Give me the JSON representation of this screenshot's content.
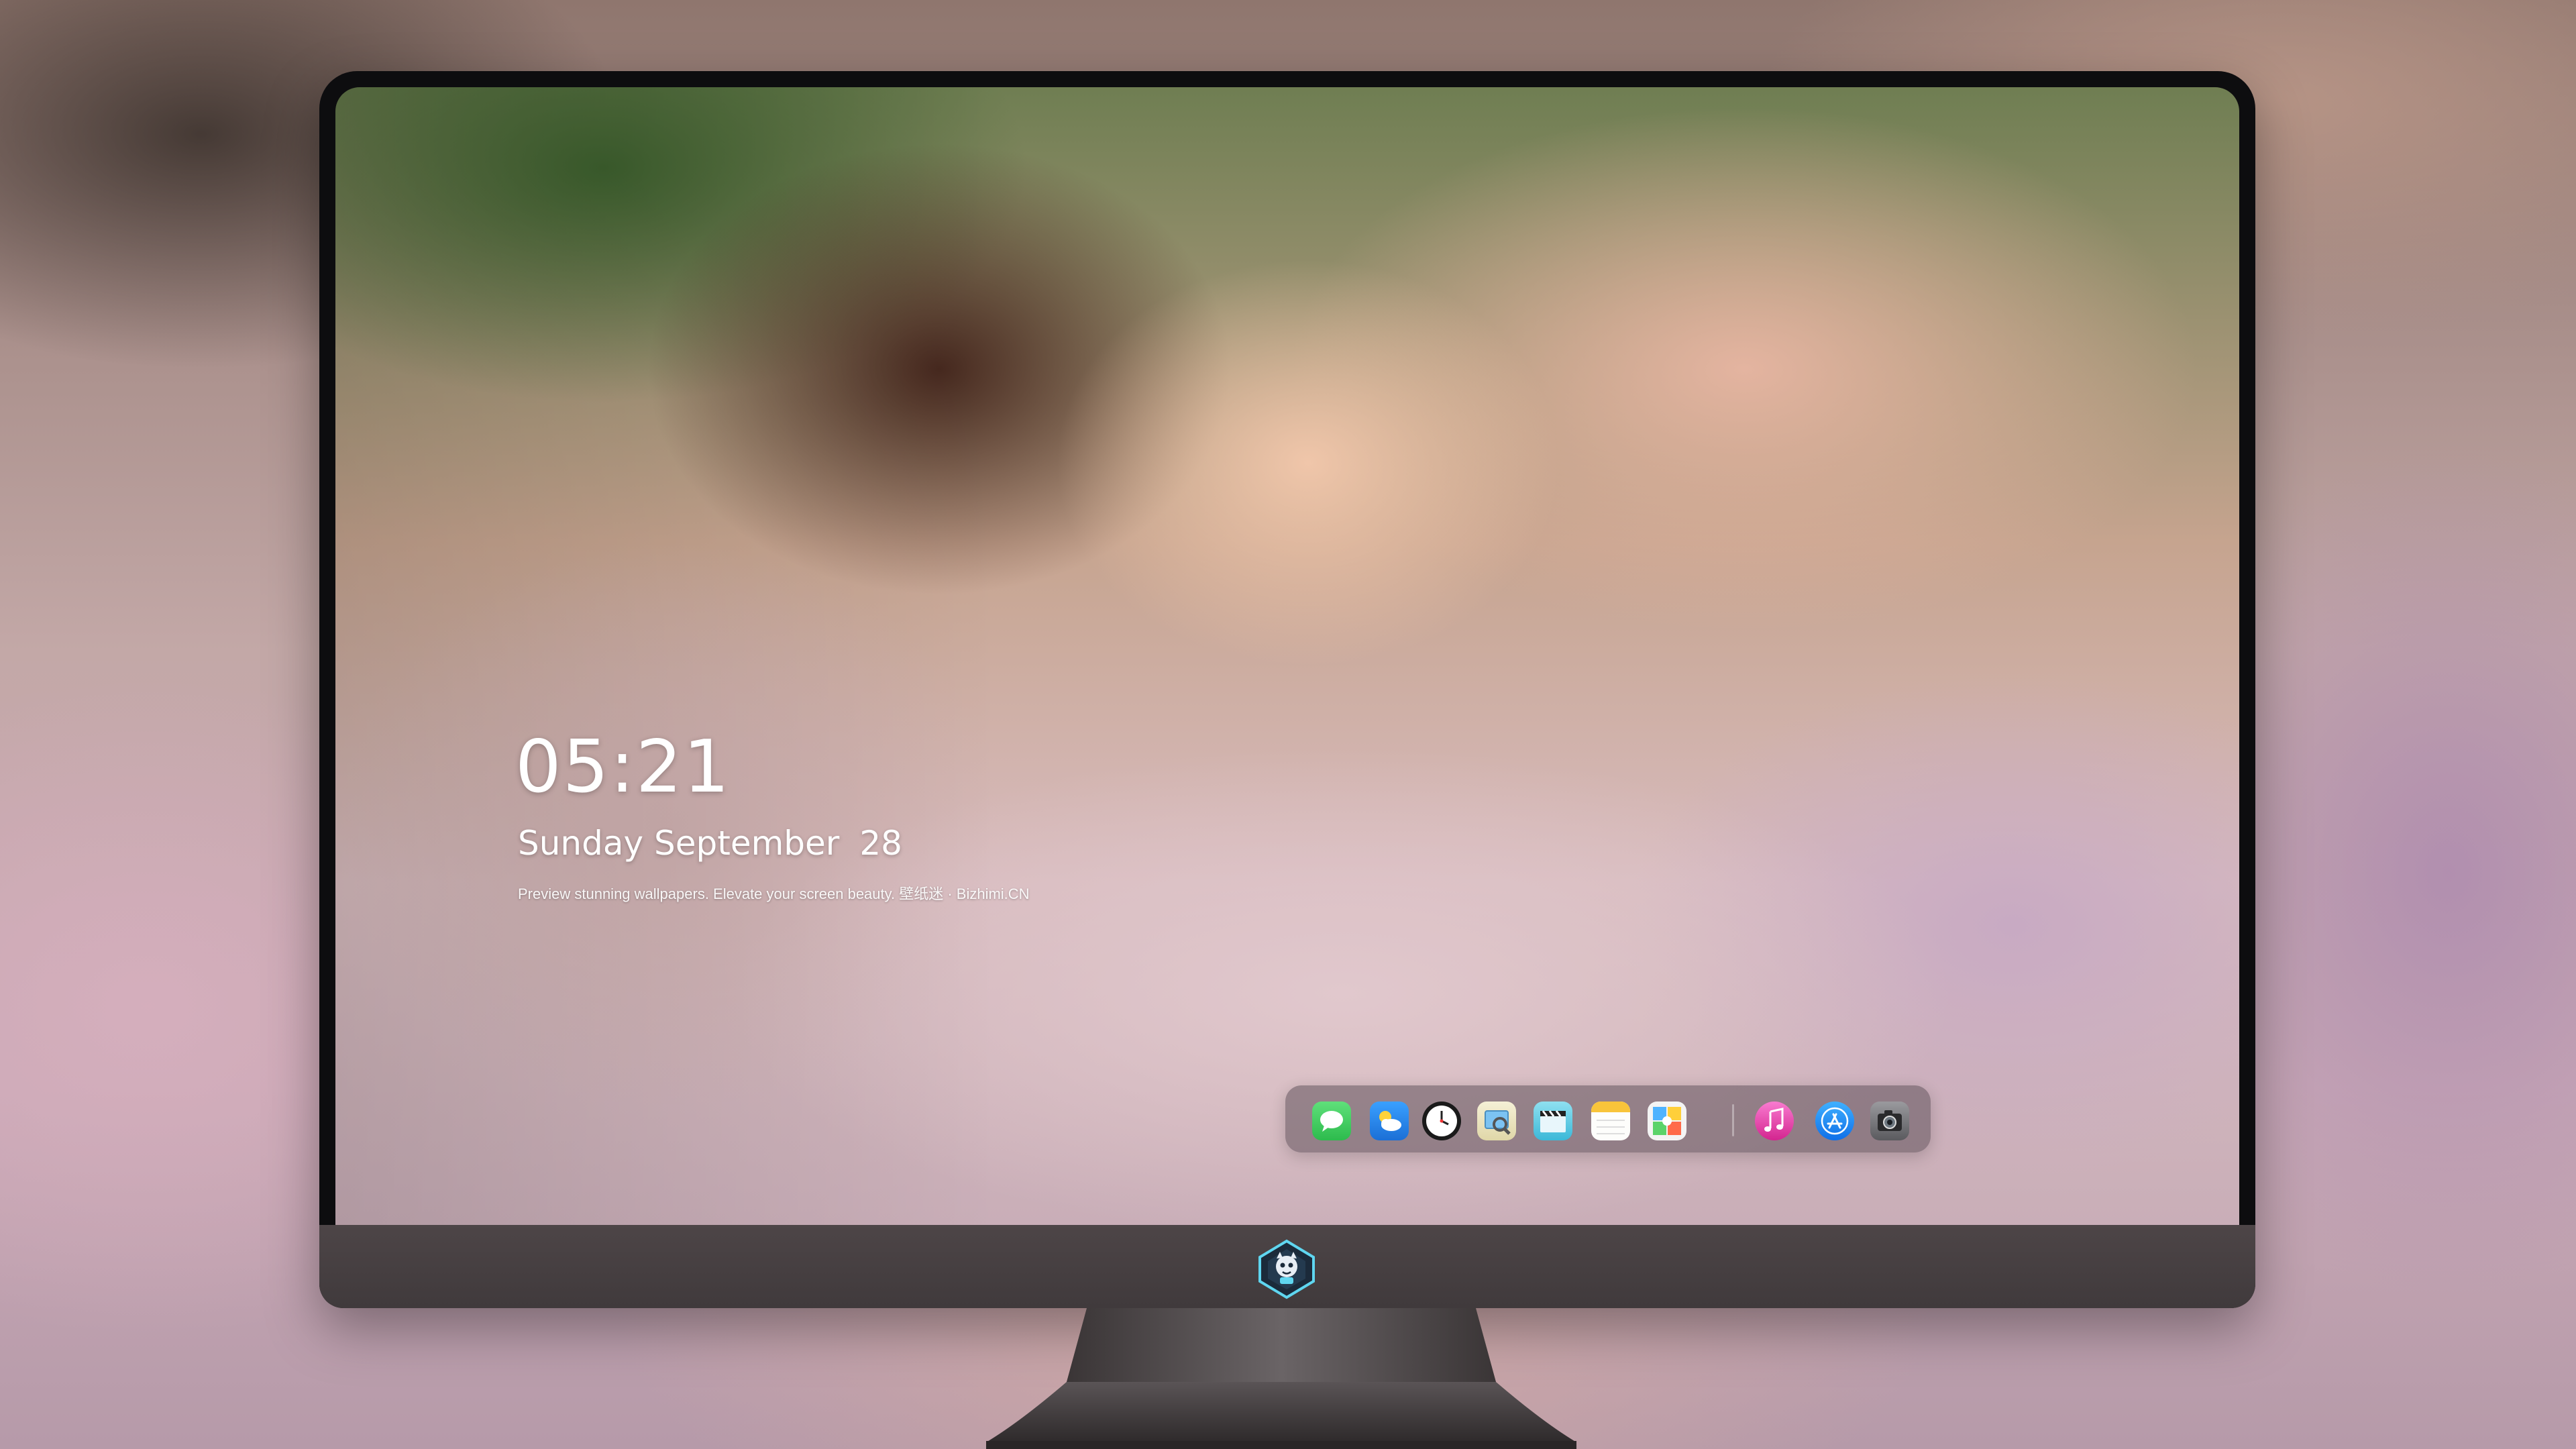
{
  "lockscreen": {
    "time": "05:21",
    "weekday_month": "Sunday September",
    "day": "28",
    "caption": "Preview stunning wallpapers. Elevate your screen beauty. 壁纸迷 · Bizhimi.CN"
  },
  "dock": {
    "apps": [
      {
        "name": "messages-icon"
      },
      {
        "name": "weather-icon"
      },
      {
        "name": "clock-icon"
      },
      {
        "name": "preview-icon"
      },
      {
        "name": "clapperboard-icon"
      },
      {
        "name": "notes-icon"
      },
      {
        "name": "photo-booth-icon"
      },
      {
        "name": "music-icon"
      },
      {
        "name": "app-store-icon"
      },
      {
        "name": "camera-icon"
      }
    ]
  },
  "colors": {
    "messages": "#34c759",
    "weather": "#2e8cf0",
    "music": "#f43fb4",
    "app_store": "#1a8cff",
    "bezel": "#0d0d0f",
    "chin": "#463f41"
  }
}
